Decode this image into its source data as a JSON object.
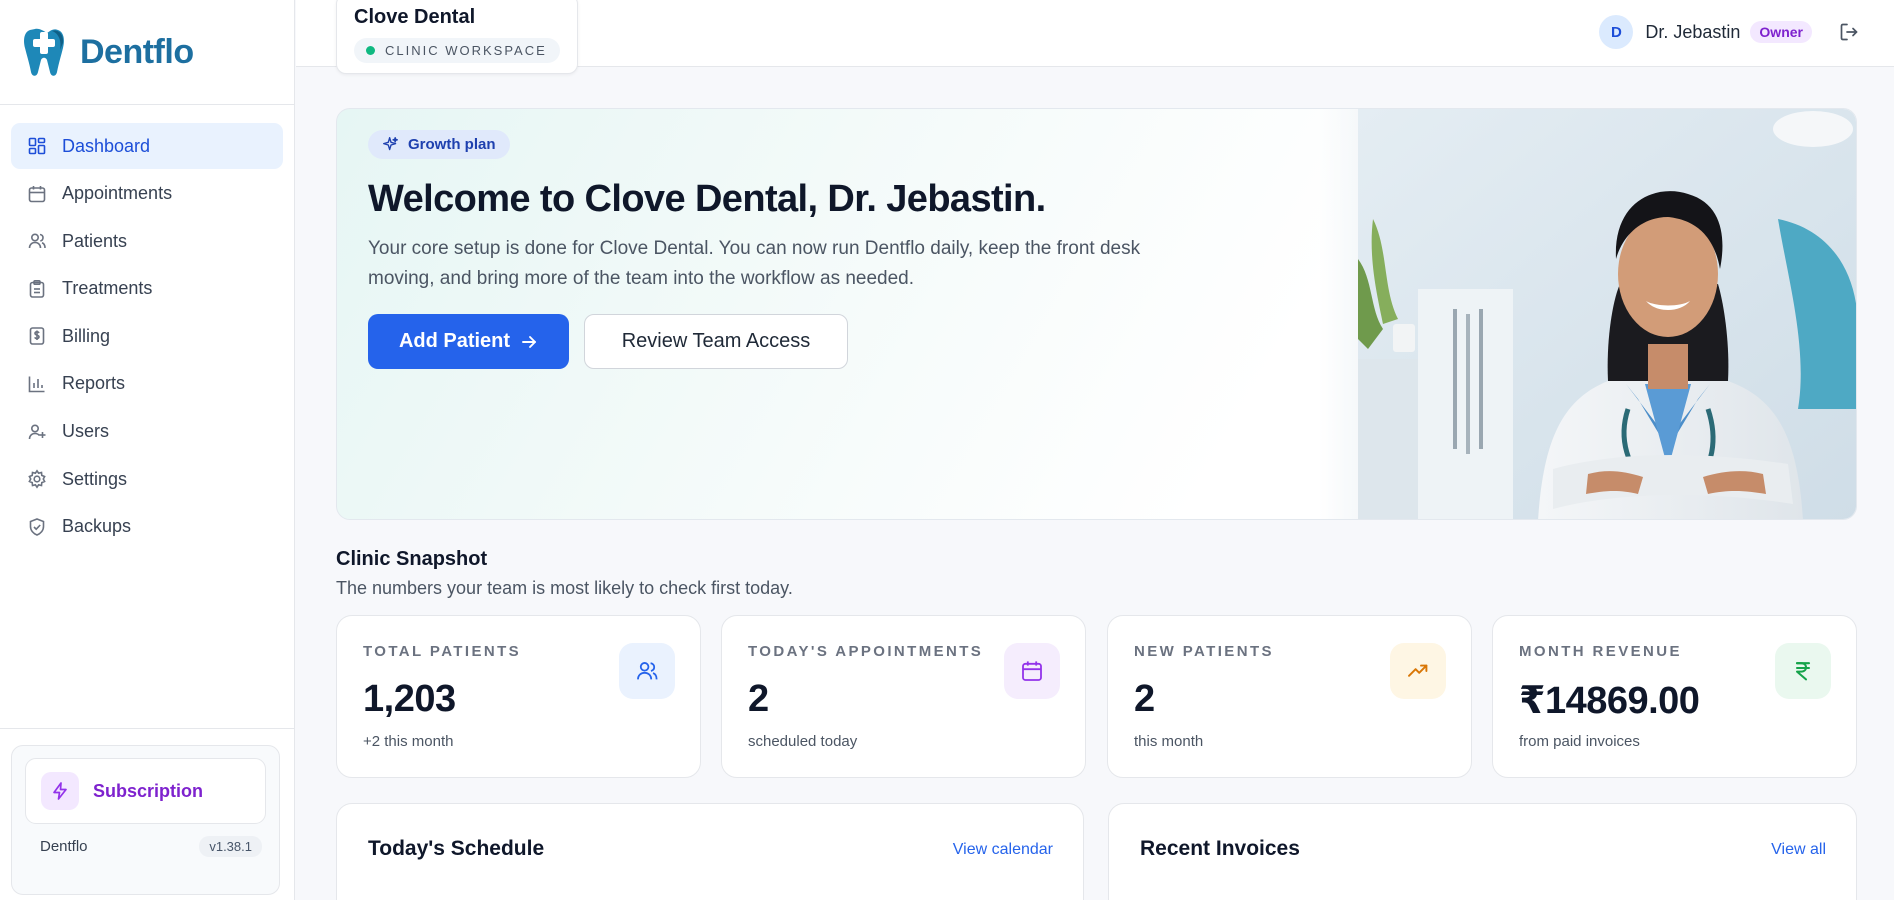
{
  "brand": {
    "name": "Dentflo"
  },
  "nav": [
    {
      "label": "Dashboard",
      "icon": "dashboard-icon",
      "active": true
    },
    {
      "label": "Appointments",
      "icon": "calendar-icon"
    },
    {
      "label": "Patients",
      "icon": "users-icon"
    },
    {
      "label": "Treatments",
      "icon": "clipboard-icon"
    },
    {
      "label": "Billing",
      "icon": "billing-icon"
    },
    {
      "label": "Reports",
      "icon": "bar-chart-icon"
    },
    {
      "label": "Users",
      "icon": "user-plus-icon"
    },
    {
      "label": "Settings",
      "icon": "gear-icon"
    },
    {
      "label": "Backups",
      "icon": "shield-check-icon"
    }
  ],
  "subscription": {
    "label": "Subscription",
    "app_name": "Dentflo",
    "version": "v1.38.1"
  },
  "topbar": {
    "clinic_name": "Clove Dental",
    "workspace_label": "CLINIC WORKSPACE",
    "avatar_initial": "D",
    "user_name": "Dr. Jebastin",
    "role": "Owner"
  },
  "hero": {
    "badge": "Growth plan",
    "title": "Welcome to Clove Dental, Dr. Jebastin.",
    "description": "Your core setup is done for Clove Dental. You can now run Dentflo daily, keep the front desk moving, and bring more of the team into the workflow as needed.",
    "primary_button": "Add Patient",
    "secondary_button": "Review Team Access"
  },
  "snapshot": {
    "title": "Clinic Snapshot",
    "subtitle": "The numbers your team is most likely to check first today.",
    "cards": [
      {
        "label": "TOTAL PATIENTS",
        "value": "1,203",
        "note": "+2 this month",
        "icon": "users-icon",
        "color": "#2563eb",
        "bg": "#eaf2fe"
      },
      {
        "label": "TODAY'S APPOINTMENTS",
        "value": "2",
        "note": "scheduled today",
        "icon": "calendar-icon",
        "color": "#9333ea",
        "bg": "#f5edfd"
      },
      {
        "label": "NEW PATIENTS",
        "value": "2",
        "note": "this month",
        "icon": "trending-up-icon",
        "color": "#d97706",
        "bg": "#fef6e4"
      },
      {
        "label": "MONTH REVENUE",
        "value": "₹14869.00",
        "note": "from paid invoices",
        "icon": "rupee-icon",
        "color": "#16a34a",
        "bg": "#eaf8ef"
      }
    ]
  },
  "panels": {
    "schedule": {
      "title": "Today's Schedule",
      "link": "View calendar"
    },
    "invoices": {
      "title": "Recent Invoices",
      "link": "View all"
    }
  },
  "colors": {
    "accent": "#2563eb",
    "brand": "#1d6fa0",
    "purple": "#7e22ce"
  }
}
